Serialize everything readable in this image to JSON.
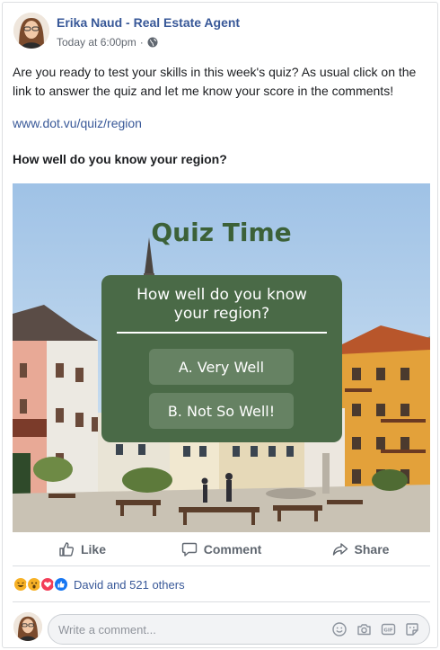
{
  "post": {
    "author": "Erika Naud - Real Estate Agent",
    "time": "Today at 6:00pm",
    "time_sep": "·",
    "text": "Are you ready to test your skills in this week's quiz? As usual click on the link to answer the quiz and let me know your score in the comments!",
    "link": "www.dot.vu/quiz/region",
    "question": "How well do you know your region?"
  },
  "image": {
    "title": "Quiz Time",
    "question_line1": "How well do you know",
    "question_line2": "your region?",
    "option_a": "A. Very Well",
    "option_b": "B. Not So Well!",
    "colors": {
      "box": "#4a6a47",
      "button": "#668263",
      "title": "#3c6138"
    }
  },
  "actions": {
    "like": "Like",
    "comment": "Comment",
    "share": "Share"
  },
  "reactions": {
    "icons": [
      "haha-icon",
      "wow-icon",
      "love-icon",
      "like-icon"
    ],
    "text": "David and 521 others"
  },
  "comment": {
    "placeholder": "Write a comment..."
  },
  "colors": {
    "link": "#385898",
    "muted": "#616770",
    "like_blue": "#1877f2"
  }
}
